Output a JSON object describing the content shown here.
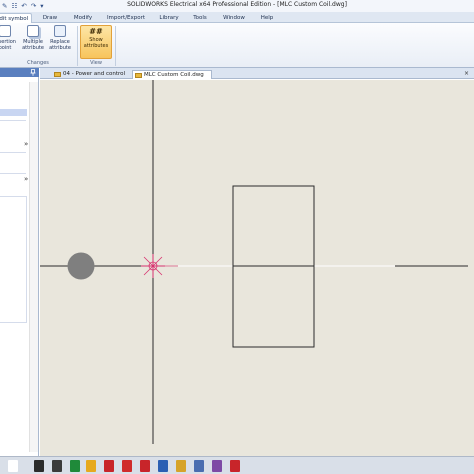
{
  "titlebar": {
    "title": "SOLIDWORKS Electrical x64 Professional Edition - [MLC Custom Coil.dwg]",
    "qat": [
      "✎",
      "☷",
      "↶",
      "↷",
      "▾"
    ]
  },
  "ribbon_tabs": [
    "Edit symbol",
    "Draw",
    "Modify",
    "Import/Export",
    "Library",
    "Tools",
    "Window",
    "Help"
  ],
  "ribbon": {
    "insertion_point": "Insertion point",
    "multiple_attribute": "Multiple attribute",
    "replace_attribute": "Replace attribute",
    "show_attributes": "Show attributes",
    "changes_group": "Changes",
    "view_group": "View",
    "hash": "##"
  },
  "left_panel": {
    "pin_icon": "pin-icon",
    "collapse": "»"
  },
  "doc_tabs": [
    {
      "label": "04 - Power and control",
      "close": "×"
    },
    {
      "label": "MLC Custom Coil.dwg",
      "close": "×"
    }
  ],
  "doc_close": "×",
  "colors": {
    "canvas": "#e9e6dc",
    "lines": "#2b2b2b",
    "ucs_marker": "#d8326f",
    "insertion_dot": "#7f7f7f",
    "highlight_button": "#f7c45c"
  },
  "taskbar": {
    "icons": [
      "start-icon",
      "folder-icon",
      "media-icon",
      "excel-icon",
      "acrobat-icon",
      "vlc-icon",
      "solidworks-icon",
      "pdf-icon",
      "word-icon",
      "electrical-icon",
      "paint-icon",
      "app-icon"
    ]
  }
}
